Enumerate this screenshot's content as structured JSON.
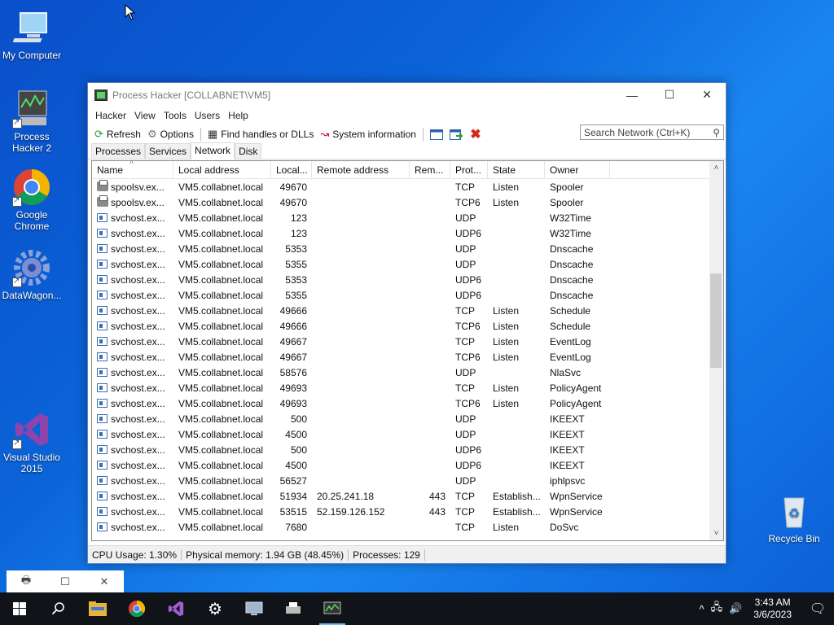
{
  "desktop": {
    "icons": [
      {
        "label": "My Computer"
      },
      {
        "label": "Process\nHacker 2"
      },
      {
        "label": "Google\nChrome"
      },
      {
        "label": "DataWagon..."
      },
      {
        "label": "Visual Studio\n2015"
      },
      {
        "label": "Recycle Bin"
      }
    ]
  },
  "window": {
    "title": "Process Hacker [COLLABNET\\VM5]",
    "menu": [
      "Hacker",
      "View",
      "Tools",
      "Users",
      "Help"
    ],
    "toolbar": {
      "refresh": "Refresh",
      "options": "Options",
      "find_handles": "Find handles or DLLs",
      "system_info": "System information"
    },
    "search_placeholder": "Search Network (Ctrl+K)",
    "tabs": [
      "Processes",
      "Services",
      "Network",
      "Disk"
    ],
    "active_tab": "Network",
    "columns": [
      "Name",
      "Local address",
      "Local...",
      "Remote address",
      "Rem...",
      "Prot...",
      "State",
      "Owner"
    ],
    "rows": [
      {
        "icon": "printer-icon",
        "name": "spoolsv.ex...",
        "local": "VM5.collabnet.local",
        "lport": "49670",
        "remote": "",
        "rport": "",
        "proto": "TCP",
        "state": "Listen",
        "owner": "Spooler"
      },
      {
        "icon": "printer-icon",
        "name": "spoolsv.ex...",
        "local": "VM5.collabnet.local",
        "lport": "49670",
        "remote": "",
        "rport": "",
        "proto": "TCP6",
        "state": "Listen",
        "owner": "Spooler"
      },
      {
        "icon": "process-icon",
        "name": "svchost.ex...",
        "local": "VM5.collabnet.local",
        "lport": "123",
        "remote": "",
        "rport": "",
        "proto": "UDP",
        "state": "",
        "owner": "W32Time"
      },
      {
        "icon": "process-icon",
        "name": "svchost.ex...",
        "local": "VM5.collabnet.local",
        "lport": "123",
        "remote": "",
        "rport": "",
        "proto": "UDP6",
        "state": "",
        "owner": "W32Time"
      },
      {
        "icon": "process-icon",
        "name": "svchost.ex...",
        "local": "VM5.collabnet.local",
        "lport": "5353",
        "remote": "",
        "rport": "",
        "proto": "UDP",
        "state": "",
        "owner": "Dnscache"
      },
      {
        "icon": "process-icon",
        "name": "svchost.ex...",
        "local": "VM5.collabnet.local",
        "lport": "5355",
        "remote": "",
        "rport": "",
        "proto": "UDP",
        "state": "",
        "owner": "Dnscache"
      },
      {
        "icon": "process-icon",
        "name": "svchost.ex...",
        "local": "VM5.collabnet.local",
        "lport": "5353",
        "remote": "",
        "rport": "",
        "proto": "UDP6",
        "state": "",
        "owner": "Dnscache"
      },
      {
        "icon": "process-icon",
        "name": "svchost.ex...",
        "local": "VM5.collabnet.local",
        "lport": "5355",
        "remote": "",
        "rport": "",
        "proto": "UDP6",
        "state": "",
        "owner": "Dnscache"
      },
      {
        "icon": "process-icon",
        "name": "svchost.ex...",
        "local": "VM5.collabnet.local",
        "lport": "49666",
        "remote": "",
        "rport": "",
        "proto": "TCP",
        "state": "Listen",
        "owner": "Schedule"
      },
      {
        "icon": "process-icon",
        "name": "svchost.ex...",
        "local": "VM5.collabnet.local",
        "lport": "49666",
        "remote": "",
        "rport": "",
        "proto": "TCP6",
        "state": "Listen",
        "owner": "Schedule"
      },
      {
        "icon": "process-icon",
        "name": "svchost.ex...",
        "local": "VM5.collabnet.local",
        "lport": "49667",
        "remote": "",
        "rport": "",
        "proto": "TCP",
        "state": "Listen",
        "owner": "EventLog"
      },
      {
        "icon": "process-icon",
        "name": "svchost.ex...",
        "local": "VM5.collabnet.local",
        "lport": "49667",
        "remote": "",
        "rport": "",
        "proto": "TCP6",
        "state": "Listen",
        "owner": "EventLog"
      },
      {
        "icon": "process-icon",
        "name": "svchost.ex...",
        "local": "VM5.collabnet.local",
        "lport": "58576",
        "remote": "",
        "rport": "",
        "proto": "UDP",
        "state": "",
        "owner": "NlaSvc"
      },
      {
        "icon": "process-icon",
        "name": "svchost.ex...",
        "local": "VM5.collabnet.local",
        "lport": "49693",
        "remote": "",
        "rport": "",
        "proto": "TCP",
        "state": "Listen",
        "owner": "PolicyAgent"
      },
      {
        "icon": "process-icon",
        "name": "svchost.ex...",
        "local": "VM5.collabnet.local",
        "lport": "49693",
        "remote": "",
        "rport": "",
        "proto": "TCP6",
        "state": "Listen",
        "owner": "PolicyAgent"
      },
      {
        "icon": "process-icon",
        "name": "svchost.ex...",
        "local": "VM5.collabnet.local",
        "lport": "500",
        "remote": "",
        "rport": "",
        "proto": "UDP",
        "state": "",
        "owner": "IKEEXT"
      },
      {
        "icon": "process-icon",
        "name": "svchost.ex...",
        "local": "VM5.collabnet.local",
        "lport": "4500",
        "remote": "",
        "rport": "",
        "proto": "UDP",
        "state": "",
        "owner": "IKEEXT"
      },
      {
        "icon": "process-icon",
        "name": "svchost.ex...",
        "local": "VM5.collabnet.local",
        "lport": "500",
        "remote": "",
        "rport": "",
        "proto": "UDP6",
        "state": "",
        "owner": "IKEEXT"
      },
      {
        "icon": "process-icon",
        "name": "svchost.ex...",
        "local": "VM5.collabnet.local",
        "lport": "4500",
        "remote": "",
        "rport": "",
        "proto": "UDP6",
        "state": "",
        "owner": "IKEEXT"
      },
      {
        "icon": "process-icon",
        "name": "svchost.ex...",
        "local": "VM5.collabnet.local",
        "lport": "56527",
        "remote": "",
        "rport": "",
        "proto": "UDP",
        "state": "",
        "owner": "iphlpsvc"
      },
      {
        "icon": "process-icon",
        "name": "svchost.ex...",
        "local": "VM5.collabnet.local",
        "lport": "51934",
        "remote": "20.25.241.18",
        "rport": "443",
        "proto": "TCP",
        "state": "Establish...",
        "owner": "WpnService"
      },
      {
        "icon": "process-icon",
        "name": "svchost.ex...",
        "local": "VM5.collabnet.local",
        "lport": "53515",
        "remote": "52.159.126.152",
        "rport": "443",
        "proto": "TCP",
        "state": "Establish...",
        "owner": "WpnService"
      },
      {
        "icon": "process-icon",
        "name": "svchost.ex...",
        "local": "VM5.collabnet.local",
        "lport": "7680",
        "remote": "",
        "rport": "",
        "proto": "TCP",
        "state": "Listen",
        "owner": "DoSvc"
      }
    ],
    "status": {
      "cpu": "CPU Usage: 1.30%",
      "memory": "Physical memory: 1.94 GB (48.45%)",
      "processes": "Processes: 129"
    }
  },
  "taskbar": {
    "time": "3:43 AM",
    "date": "3/6/2023"
  }
}
